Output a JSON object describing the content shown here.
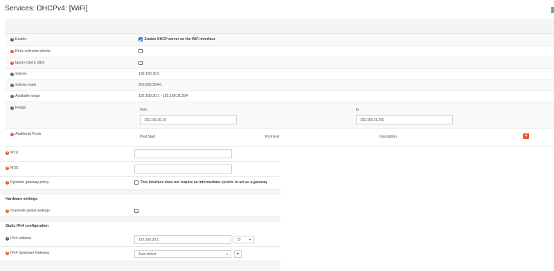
{
  "page": {
    "title": "Services: DHCPv4: [WiFi]",
    "status_color": "#5cb85c"
  },
  "general": {
    "enable": {
      "label": "Enable",
      "checkbox_label": "Enable DHCP server on the WiFi interface",
      "checked": true
    },
    "deny_unknown": {
      "label": "Deny unknown clients"
    },
    "ignore_uids": {
      "label": "Ignore Client UIDs"
    },
    "subnet": {
      "label": "Subnet",
      "value": "192.168.30.0"
    },
    "subnet_mask": {
      "label": "Subnet mask",
      "value": "255.255.254.0"
    },
    "available_range": {
      "label": "Available range",
      "value": "192.168.30.1 - 192.168.31.254"
    },
    "range": {
      "label": "Range",
      "from_label": "from",
      "to_label": "to",
      "from_value": "192.168.30.10",
      "to_value": "192.168.31.200"
    },
    "pools": {
      "label": "Additional Pools",
      "col_start": "Pool Start",
      "col_end": "Pool End",
      "col_desc": "Description",
      "add_symbol": "+"
    }
  },
  "iface": {
    "mtu": {
      "label": "MTU",
      "value": ""
    },
    "mss": {
      "label": "MSS",
      "value": ""
    },
    "gateway_policy": {
      "label": "Dynamic gateway policy",
      "checkbox_label": "This interface does not require an intermediate system to act as a gateway"
    }
  },
  "hardware": {
    "title": "Hardware settings",
    "overwrite": {
      "label": "Overwrite global settings"
    }
  },
  "static_ipv4": {
    "title": "Static IPv4 configuration",
    "address": {
      "label": "IPv4 address",
      "value": "192.168.30.1",
      "prefix": "23"
    },
    "gateway": {
      "label": "IPv4 Upstream Gateway",
      "value": "Auto-detect",
      "add_symbol": "+"
    }
  },
  "icons": {
    "info": "info-icon",
    "warn": "warning-icon",
    "accent": "#e8572a"
  }
}
